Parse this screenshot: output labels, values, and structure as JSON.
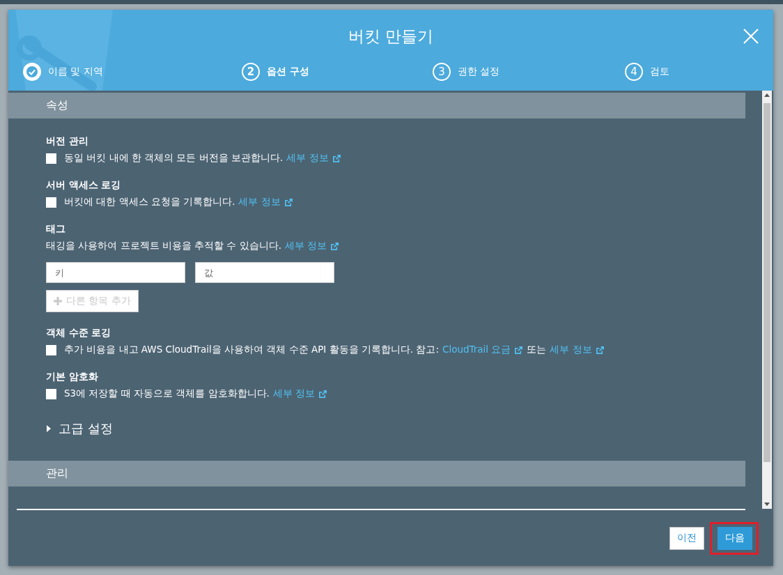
{
  "dialog": {
    "title": "버킷 만들기"
  },
  "steps": [
    {
      "label": "이름 및 지역",
      "completed": true,
      "selected": false
    },
    {
      "number": "2",
      "label": "옵션 구성",
      "completed": false,
      "selected": true
    },
    {
      "number": "3",
      "label": "권한 설정",
      "completed": false,
      "selected": false
    },
    {
      "number": "4",
      "label": "검토",
      "completed": false,
      "selected": false
    }
  ],
  "sections": [
    {
      "title": "속성",
      "items": [
        {
          "kind": "checkbox",
          "title": "버전 관리",
          "checked": false,
          "parts": [
            {
              "kind": "text",
              "text": "동일 버킷 내에 한 객체의 모든 버전을 보관합니다."
            },
            {
              "kind": "link",
              "text": "세부 정보"
            }
          ]
        },
        {
          "kind": "checkbox",
          "title": "서버 액세스 로깅",
          "checked": false,
          "parts": [
            {
              "kind": "text",
              "text": "버킷에 대한 액세스 요청을 기록합니다."
            },
            {
              "kind": "link",
              "text": "세부 정보"
            }
          ]
        },
        {
          "kind": "tags",
          "title": "태그",
          "parts": [
            {
              "kind": "text",
              "text": "태깅을 사용하여 프로젝트 비용을 추적할 수 있습니다."
            },
            {
              "kind": "link",
              "text": "세부 정보"
            }
          ],
          "key_placeholder": "키",
          "value_placeholder": "값",
          "add_button": {
            "label": "다른 항목 추가",
            "disabled": true
          }
        },
        {
          "kind": "checkbox",
          "title": "객체 수준 로깅",
          "checked": false,
          "parts": [
            {
              "kind": "text",
              "text": "추가 비용을 내고 AWS CloudTrail을 사용하여 객체 수준 API 활동을 기록합니다. 참고:"
            },
            {
              "kind": "link",
              "text": "CloudTrail 요금"
            },
            {
              "kind": "text",
              "text": "또는"
            },
            {
              "kind": "link",
              "text": "세부 정보"
            }
          ]
        },
        {
          "kind": "checkbox",
          "title": "기본 암호화",
          "checked": false,
          "parts": [
            {
              "kind": "text",
              "text": "S3에 저장할 때 자동으로 객체를 암호화합니다."
            },
            {
              "kind": "link",
              "text": "세부 정보"
            }
          ]
        }
      ],
      "advanced": {
        "label": "고급 설정",
        "expanded": false
      }
    },
    {
      "title": "관리"
    }
  ],
  "footer": {
    "buttons": [
      {
        "label": "이전",
        "primary": false,
        "highlighted": false
      },
      {
        "label": "다음",
        "primary": true,
        "highlighted": true
      }
    ]
  }
}
